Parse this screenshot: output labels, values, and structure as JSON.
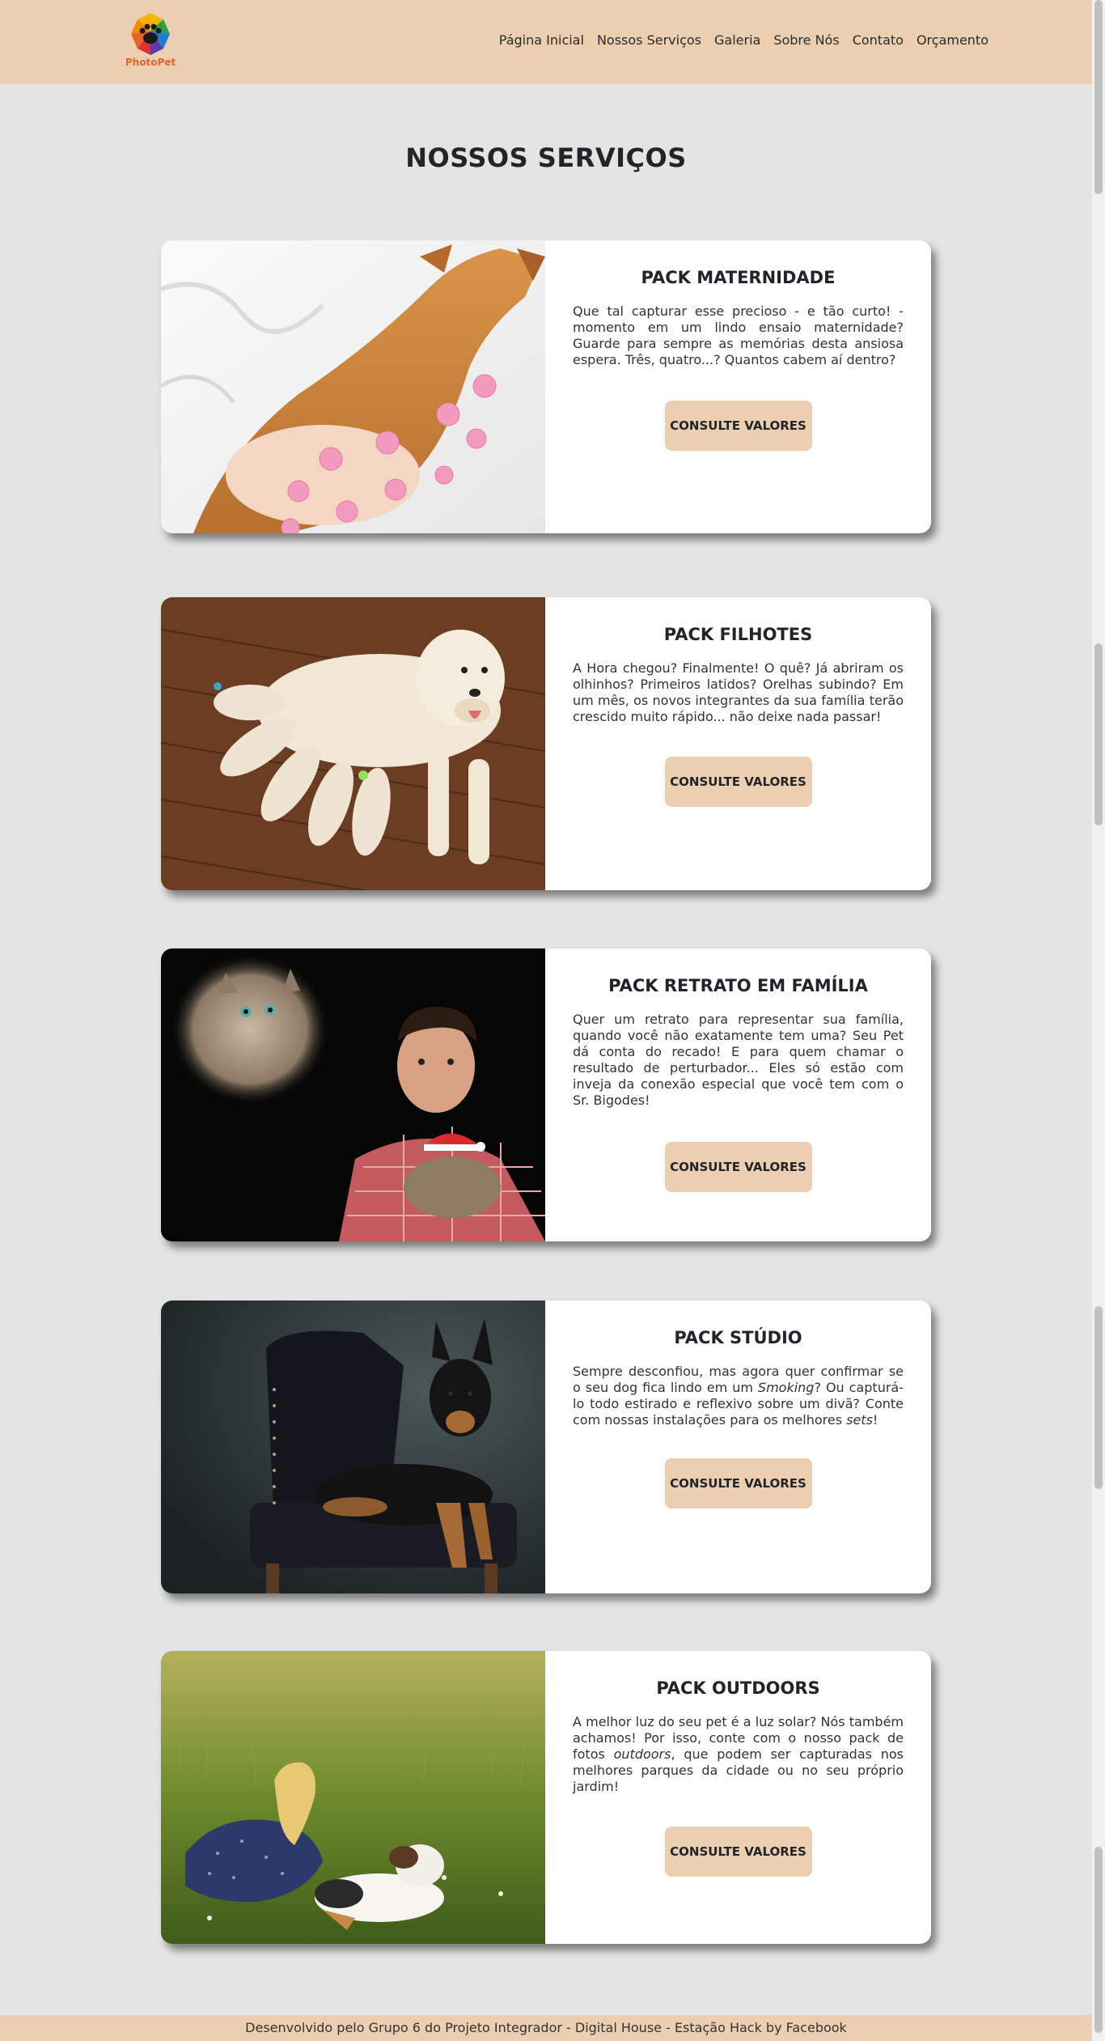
{
  "brand": {
    "logo_text": "PhotoPet"
  },
  "nav": {
    "items": [
      {
        "label": "Página Inicial"
      },
      {
        "label": "Nossos Serviços"
      },
      {
        "label": "Galeria"
      },
      {
        "label": "Sobre Nós"
      },
      {
        "label": "Contato"
      },
      {
        "label": "Orçamento"
      }
    ]
  },
  "page": {
    "title": "NOSSOS SERVIÇOS"
  },
  "services": [
    {
      "title": "PACK MATERNIDADE",
      "text": "Que tal capturar esse precioso - e tão curto! - momento em um lindo ensaio maternidade? Guarde para sempre as memórias desta ansiosa espera. Três, quatro...? Quantos cabem aí dentro?",
      "button": "CONSULTE VALORES",
      "photo": "pregnant-dog-photo"
    },
    {
      "title": "PACK FILHOTES",
      "text": "A Hora chegou? Finalmente! O quê? Já abriram os olhinhos? Primeiros latidos? Orelhas subindo? Em um mês, os novos integrantes da sua família terão crescido muito rápido... não deixe nada passar!",
      "button": "CONSULTE VALORES",
      "photo": "golden-retriever-puppies-photo"
    },
    {
      "title": "PACK RETRATO EM FAMÍLIA",
      "text": "Quer um retrato para representar sua família, quando você não exatamente tem uma? Seu Pet dá conta do recado! E para quem chamar o resultado de perturbador... Eles só estão com inveja da conexão especial que você tem com o Sr. Bigodes!",
      "button": "CONSULTE VALORES",
      "photo": "man-with-cat-portrait-photo"
    },
    {
      "title": "PACK STÚDIO",
      "text_parts": [
        "Sempre desconfiou, mas agora quer confirmar se o seu dog fica lindo em um ",
        "Smoking",
        "? Ou capturá-lo todo estirado e reflexivo sobre um divã? Conte com nossas instalações para os melhores ",
        "sets",
        "!"
      ],
      "button": "CONSULTE VALORES",
      "photo": "dog-on-armchair-studio-photo"
    },
    {
      "title": "PACK OUTDOORS",
      "text_parts": [
        "A melhor luz do seu pet é a luz solar? Nós também achamos! Por isso, conte com o nosso pack de fotos ",
        "outdoors",
        ", que podem ser capturadas nos melhores parques da cidade ou no seu próprio jardim!"
      ],
      "button": "CONSULTE VALORES",
      "photo": "woman-with-collie-outdoors-photo"
    }
  ],
  "footer": {
    "text": "Desenvolvido pelo Grupo 6 do Projeto Integrador - Digital House - Estação Hack by Facebook"
  },
  "colors": {
    "header_bg": "#ebcfb0",
    "page_bg": "#e4e4e4",
    "button_bg": "#ebcfb0",
    "logo_text": "#e8622d"
  }
}
